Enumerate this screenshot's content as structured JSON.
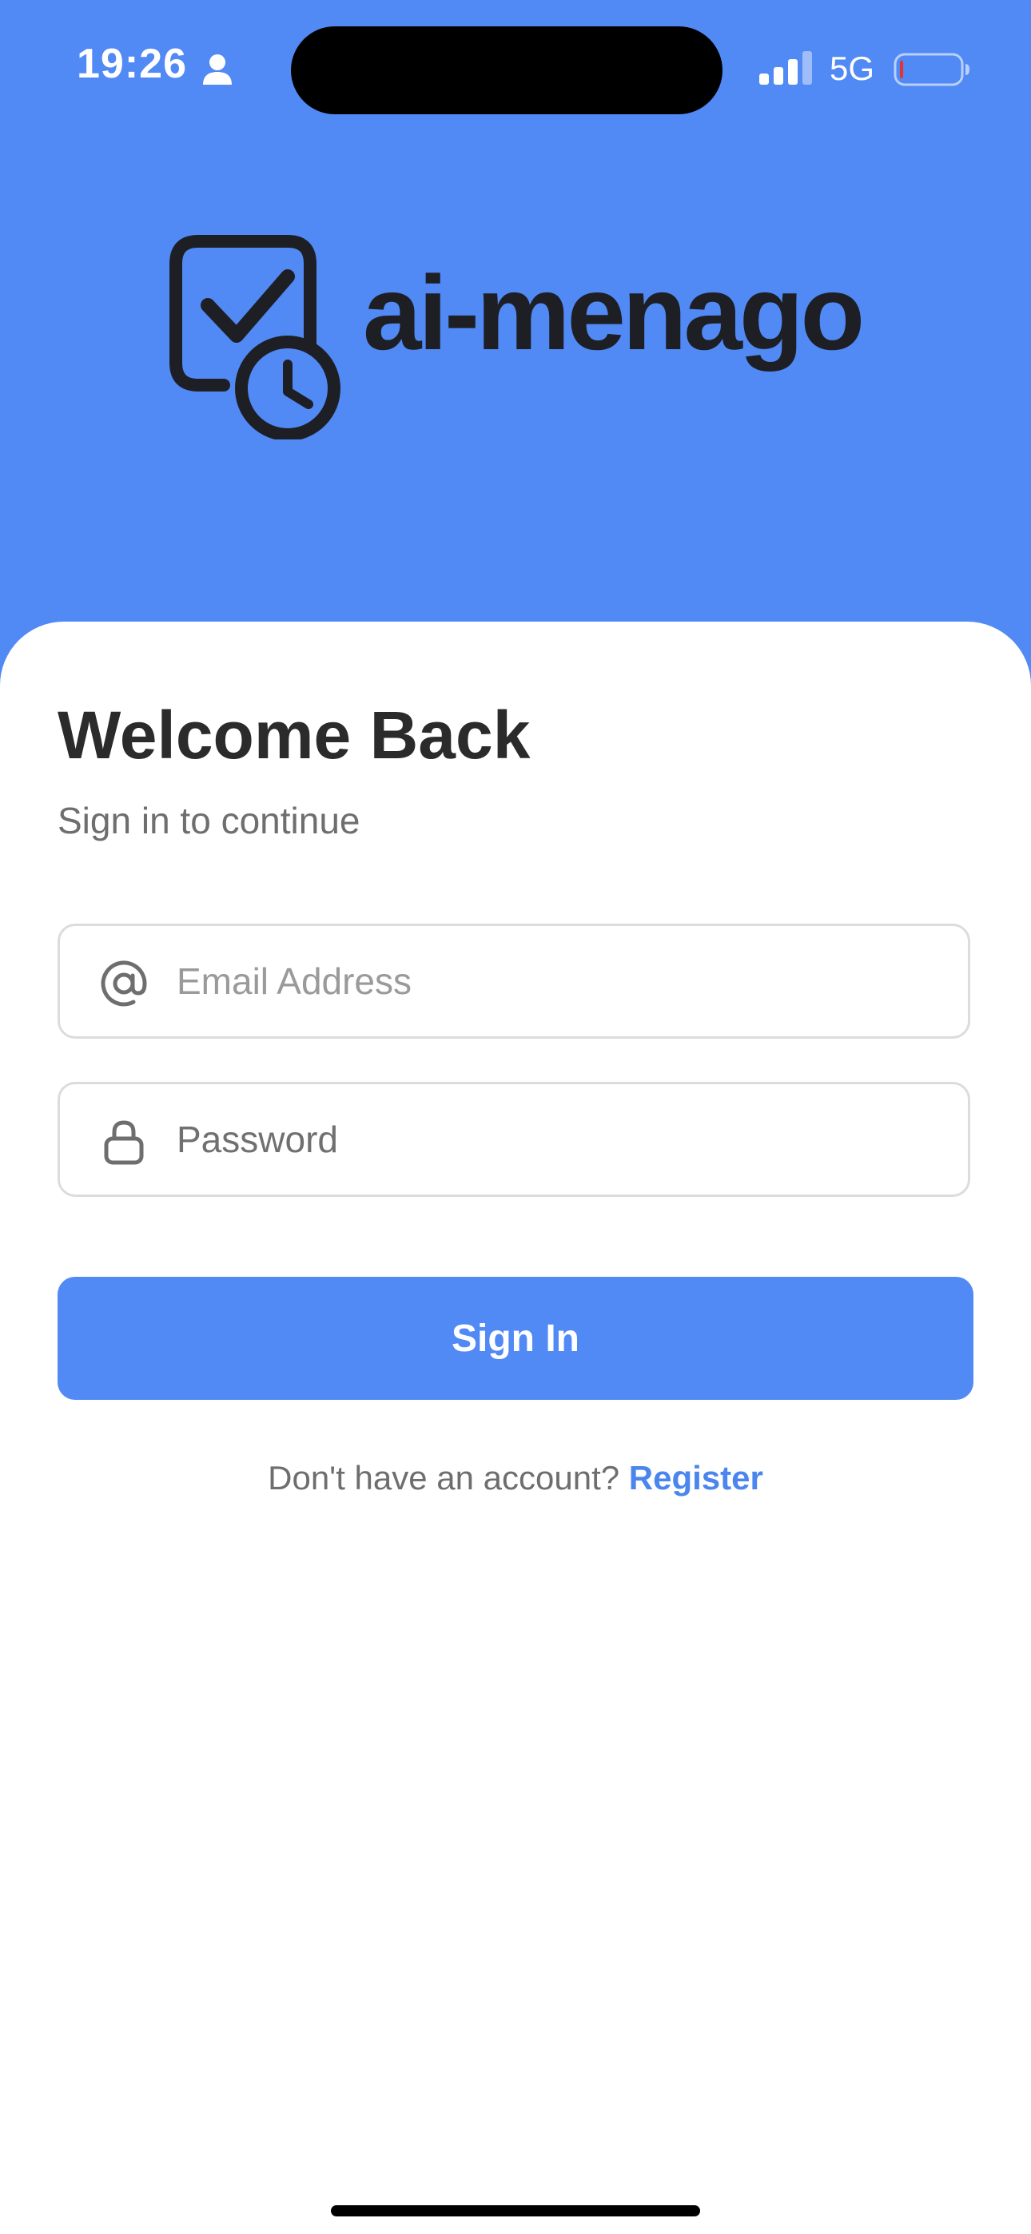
{
  "status_bar": {
    "time": "19:26",
    "network": "5G",
    "icons": [
      "person-icon",
      "signal-icon",
      "battery-icon"
    ]
  },
  "logo": {
    "icon": "calendar-check-clock-icon",
    "text": "ai-menago"
  },
  "login": {
    "title": "Welcome Back",
    "subtitle": "Sign in to continue",
    "email": {
      "icon": "at-sign-icon",
      "placeholder": "Email Address",
      "value": ""
    },
    "password": {
      "icon": "lock-icon",
      "placeholder": "Password",
      "value": ""
    },
    "submit_label": "Sign In",
    "register_prompt": "Don't have an account?",
    "register_link": "Register"
  },
  "colors": {
    "primary": "#5189F5",
    "link": "#4A86EE",
    "title": "#2B2B2B",
    "muted": "#6E6E6E",
    "border": "#DCDCDC"
  }
}
